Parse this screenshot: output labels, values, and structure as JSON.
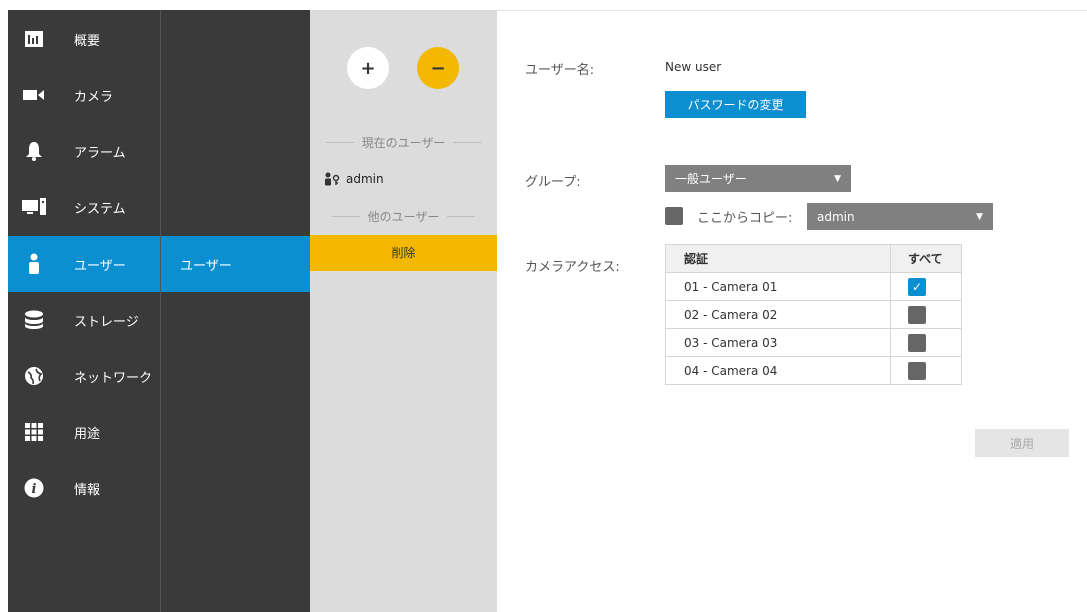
{
  "nav": {
    "items": [
      {
        "label": "概要",
        "icon": "bar-chart-icon"
      },
      {
        "label": "カメラ",
        "icon": "video-camera-icon"
      },
      {
        "label": "アラーム",
        "icon": "bell-icon"
      },
      {
        "label": "システム",
        "icon": "computer-icon"
      },
      {
        "label": "ユーザー",
        "icon": "user-icon"
      },
      {
        "label": "ストレージ",
        "icon": "database-icon"
      },
      {
        "label": "ネットワーク",
        "icon": "globe-icon"
      },
      {
        "label": "用途",
        "icon": "grid-icon"
      },
      {
        "label": "情報",
        "icon": "info-icon"
      }
    ]
  },
  "subnav": {
    "active_label": "ユーザー"
  },
  "users_panel": {
    "add_symbol": "+",
    "remove_symbol": "−",
    "current_users_header": "現在のユーザー",
    "current_user": "admin",
    "other_users_header": "他のユーザー",
    "delete_label": "削除"
  },
  "form": {
    "username_label": "ユーザー名:",
    "username_value": "New user",
    "change_password_label": "パスワードの変更",
    "group_label": "グループ:",
    "group_value": "一般ユーザー",
    "copy_label": "ここからコピー:",
    "copy_value": "admin",
    "camera_access_label": "カメラアクセス:",
    "table": {
      "col_auth": "認証",
      "col_all": "すべて",
      "rows": [
        {
          "name": "01 - Camera 01",
          "checked": true
        },
        {
          "name": "02 - Camera 02",
          "checked": false
        },
        {
          "name": "03 - Camera 03",
          "checked": false
        },
        {
          "name": "04 - Camera 04",
          "checked": false
        }
      ]
    },
    "apply_label": "適用"
  },
  "colors": {
    "nav_bg": "#3a3a3a",
    "accent_blue": "#0b8fd0",
    "accent_yellow": "#f5b800",
    "panel_gray": "#dcdcdc"
  }
}
